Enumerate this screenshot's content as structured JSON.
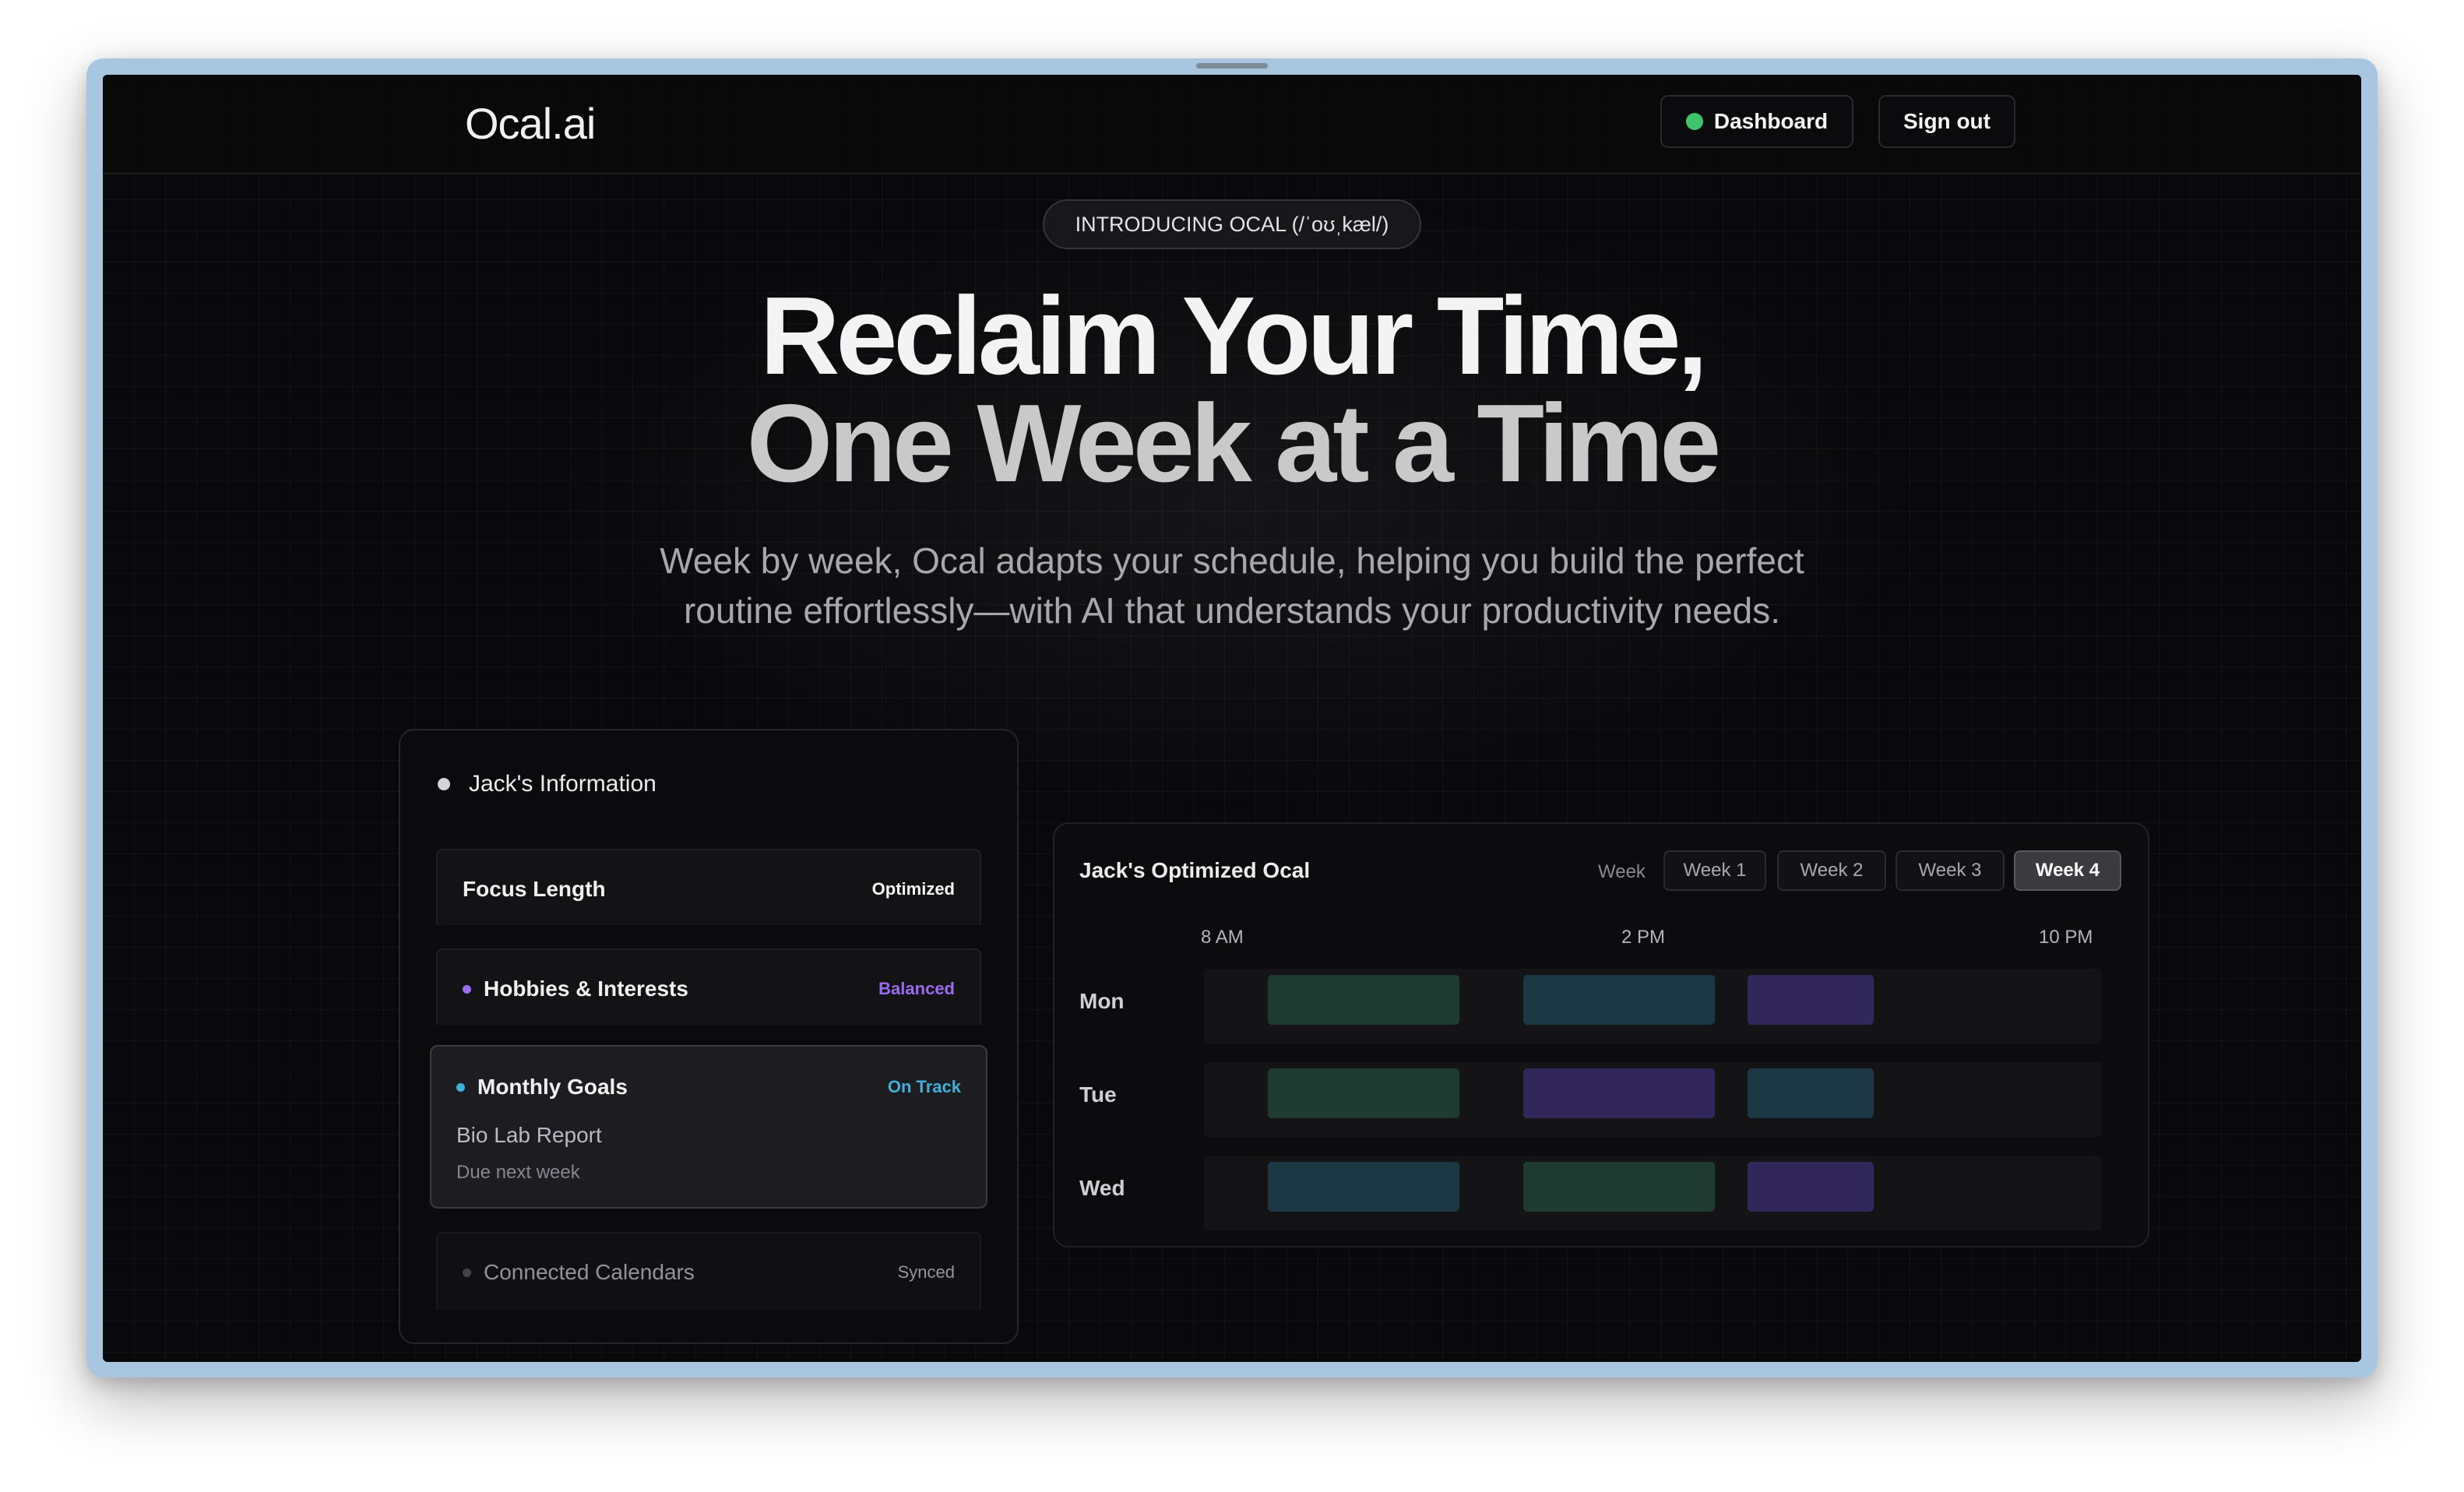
{
  "header": {
    "logo": "Ocal.ai",
    "dashboard_label": "Dashboard",
    "signout_label": "Sign out"
  },
  "hero": {
    "pill": "INTRODUCING OCAL (/ˈoʊˌkæl/)",
    "title_line1": "Reclaim Your Time,",
    "title_line2": "One Week at a Time",
    "subtitle": "Week by week, Ocal adapts your schedule, helping you build the perfect routine effortlessly—with AI that understands your productivity needs."
  },
  "info_card": {
    "title": "Jack's Information",
    "items": [
      {
        "label": "Focus Length",
        "status": "Optimized",
        "status_color": "#f4f4f5",
        "dot_color": ""
      },
      {
        "label": "Hobbies & Interests",
        "status": "Balanced",
        "status_color": "#9b6bf0",
        "dot_color": "#9b6bf0"
      },
      {
        "label": "Monthly Goals",
        "status": "On Track",
        "status_color": "#3fb0d6",
        "dot_color": "#3fb0d6",
        "goal_title": "Bio Lab Report",
        "goal_due": "Due next week"
      },
      {
        "label": "Connected Calendars",
        "status": "Synced",
        "status_color": "#c9c9cf",
        "dot_color": "#5a5a60"
      }
    ]
  },
  "schedule": {
    "title": "Jack's Optimized Ocal",
    "week_label": "Week",
    "tabs": [
      "Week 1",
      "Week 2",
      "Week 3",
      "Week 4"
    ],
    "active_tab": "Week 4",
    "times": [
      "8 AM",
      "2 PM",
      "10 PM"
    ],
    "days": [
      "Mon",
      "Tue",
      "Wed"
    ],
    "colors": {
      "green": "#1f3a30",
      "teal": "#1c3844",
      "purple": "#31275a"
    }
  }
}
